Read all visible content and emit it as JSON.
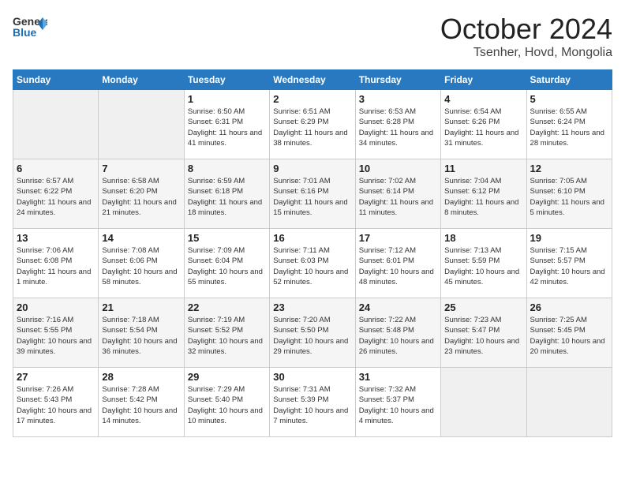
{
  "header": {
    "logo_general": "General",
    "logo_blue": "Blue",
    "month_title": "October 2024",
    "location": "Tsenher, Hovd, Mongolia"
  },
  "weekdays": [
    "Sunday",
    "Monday",
    "Tuesday",
    "Wednesday",
    "Thursday",
    "Friday",
    "Saturday"
  ],
  "weeks": [
    [
      {
        "day": "",
        "info": ""
      },
      {
        "day": "",
        "info": ""
      },
      {
        "day": "1",
        "info": "Sunrise: 6:50 AM\nSunset: 6:31 PM\nDaylight: 11 hours and 41 minutes."
      },
      {
        "day": "2",
        "info": "Sunrise: 6:51 AM\nSunset: 6:29 PM\nDaylight: 11 hours and 38 minutes."
      },
      {
        "day": "3",
        "info": "Sunrise: 6:53 AM\nSunset: 6:28 PM\nDaylight: 11 hours and 34 minutes."
      },
      {
        "day": "4",
        "info": "Sunrise: 6:54 AM\nSunset: 6:26 PM\nDaylight: 11 hours and 31 minutes."
      },
      {
        "day": "5",
        "info": "Sunrise: 6:55 AM\nSunset: 6:24 PM\nDaylight: 11 hours and 28 minutes."
      }
    ],
    [
      {
        "day": "6",
        "info": "Sunrise: 6:57 AM\nSunset: 6:22 PM\nDaylight: 11 hours and 24 minutes."
      },
      {
        "day": "7",
        "info": "Sunrise: 6:58 AM\nSunset: 6:20 PM\nDaylight: 11 hours and 21 minutes."
      },
      {
        "day": "8",
        "info": "Sunrise: 6:59 AM\nSunset: 6:18 PM\nDaylight: 11 hours and 18 minutes."
      },
      {
        "day": "9",
        "info": "Sunrise: 7:01 AM\nSunset: 6:16 PM\nDaylight: 11 hours and 15 minutes."
      },
      {
        "day": "10",
        "info": "Sunrise: 7:02 AM\nSunset: 6:14 PM\nDaylight: 11 hours and 11 minutes."
      },
      {
        "day": "11",
        "info": "Sunrise: 7:04 AM\nSunset: 6:12 PM\nDaylight: 11 hours and 8 minutes."
      },
      {
        "day": "12",
        "info": "Sunrise: 7:05 AM\nSunset: 6:10 PM\nDaylight: 11 hours and 5 minutes."
      }
    ],
    [
      {
        "day": "13",
        "info": "Sunrise: 7:06 AM\nSunset: 6:08 PM\nDaylight: 11 hours and 1 minute."
      },
      {
        "day": "14",
        "info": "Sunrise: 7:08 AM\nSunset: 6:06 PM\nDaylight: 10 hours and 58 minutes."
      },
      {
        "day": "15",
        "info": "Sunrise: 7:09 AM\nSunset: 6:04 PM\nDaylight: 10 hours and 55 minutes."
      },
      {
        "day": "16",
        "info": "Sunrise: 7:11 AM\nSunset: 6:03 PM\nDaylight: 10 hours and 52 minutes."
      },
      {
        "day": "17",
        "info": "Sunrise: 7:12 AM\nSunset: 6:01 PM\nDaylight: 10 hours and 48 minutes."
      },
      {
        "day": "18",
        "info": "Sunrise: 7:13 AM\nSunset: 5:59 PM\nDaylight: 10 hours and 45 minutes."
      },
      {
        "day": "19",
        "info": "Sunrise: 7:15 AM\nSunset: 5:57 PM\nDaylight: 10 hours and 42 minutes."
      }
    ],
    [
      {
        "day": "20",
        "info": "Sunrise: 7:16 AM\nSunset: 5:55 PM\nDaylight: 10 hours and 39 minutes."
      },
      {
        "day": "21",
        "info": "Sunrise: 7:18 AM\nSunset: 5:54 PM\nDaylight: 10 hours and 36 minutes."
      },
      {
        "day": "22",
        "info": "Sunrise: 7:19 AM\nSunset: 5:52 PM\nDaylight: 10 hours and 32 minutes."
      },
      {
        "day": "23",
        "info": "Sunrise: 7:20 AM\nSunset: 5:50 PM\nDaylight: 10 hours and 29 minutes."
      },
      {
        "day": "24",
        "info": "Sunrise: 7:22 AM\nSunset: 5:48 PM\nDaylight: 10 hours and 26 minutes."
      },
      {
        "day": "25",
        "info": "Sunrise: 7:23 AM\nSunset: 5:47 PM\nDaylight: 10 hours and 23 minutes."
      },
      {
        "day": "26",
        "info": "Sunrise: 7:25 AM\nSunset: 5:45 PM\nDaylight: 10 hours and 20 minutes."
      }
    ],
    [
      {
        "day": "27",
        "info": "Sunrise: 7:26 AM\nSunset: 5:43 PM\nDaylight: 10 hours and 17 minutes."
      },
      {
        "day": "28",
        "info": "Sunrise: 7:28 AM\nSunset: 5:42 PM\nDaylight: 10 hours and 14 minutes."
      },
      {
        "day": "29",
        "info": "Sunrise: 7:29 AM\nSunset: 5:40 PM\nDaylight: 10 hours and 10 minutes."
      },
      {
        "day": "30",
        "info": "Sunrise: 7:31 AM\nSunset: 5:39 PM\nDaylight: 10 hours and 7 minutes."
      },
      {
        "day": "31",
        "info": "Sunrise: 7:32 AM\nSunset: 5:37 PM\nDaylight: 10 hours and 4 minutes."
      },
      {
        "day": "",
        "info": ""
      },
      {
        "day": "",
        "info": ""
      }
    ]
  ]
}
